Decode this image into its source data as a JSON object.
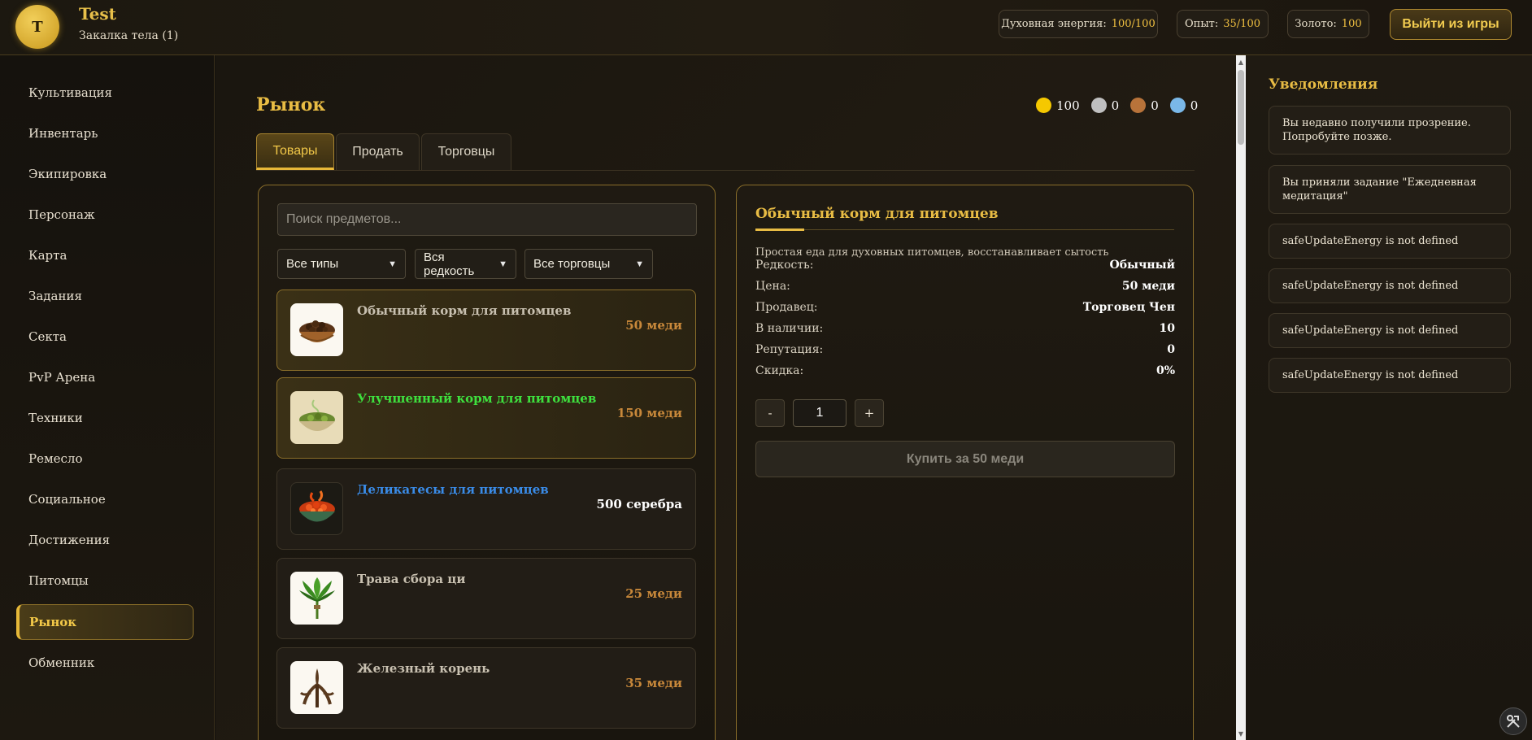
{
  "player": {
    "avatar_letter": "T",
    "name": "Test",
    "realm": "Закалка тела (1)"
  },
  "stats": {
    "energy_label": "Духовная энергия:",
    "energy_value": "100/100",
    "exp_label": "Опыт:",
    "exp_value": "35/100",
    "gold_label": "Золото:",
    "gold_value": "100"
  },
  "header": {
    "exit_label": "Выйти из игры"
  },
  "sidebar": {
    "items": [
      {
        "label": "Культивация"
      },
      {
        "label": "Инвентарь"
      },
      {
        "label": "Экипировка"
      },
      {
        "label": "Персонаж"
      },
      {
        "label": "Карта"
      },
      {
        "label": "Задания"
      },
      {
        "label": "Секта"
      },
      {
        "label": "PvP Арена"
      },
      {
        "label": "Техники"
      },
      {
        "label": "Ремесло"
      },
      {
        "label": "Социальное"
      },
      {
        "label": "Достижения"
      },
      {
        "label": "Питомцы"
      },
      {
        "label": "Рынок",
        "active": true
      },
      {
        "label": "Обменник"
      }
    ]
  },
  "market": {
    "title": "Рынок",
    "currencies": [
      {
        "value": "100",
        "color": "#f5c800"
      },
      {
        "value": "0",
        "color": "#c0c0c0"
      },
      {
        "value": "0",
        "color": "#b8733a"
      },
      {
        "value": "0",
        "color": "#7ab8e8"
      }
    ],
    "tabs": [
      {
        "label": "Товары",
        "active": true
      },
      {
        "label": "Продать"
      },
      {
        "label": "Торговцы"
      }
    ],
    "search_placeholder": "Поиск предметов...",
    "filters": {
      "type": "Все типы",
      "rarity": "Вся редкость",
      "trader": "Все торговцы"
    },
    "items": [
      {
        "name": "Обычный корм для питомцев",
        "price": "50 меди",
        "name_color": "#c8c0b0",
        "price_color": "#c8883a",
        "icon": "pet-food-bowl-icon",
        "selected": true
      },
      {
        "name": "Улучшенный корм для питомцев",
        "price": "150 меди",
        "name_color": "#3ee03e",
        "price_color": "#c8883a",
        "icon": "improved-pet-food-icon",
        "selected": true
      },
      {
        "name": "Деликатесы для питомцев",
        "price": "500 серебра",
        "name_color": "#3a8ce8",
        "price_color": "#ffffff",
        "icon": "pet-delicacy-icon"
      },
      {
        "name": "Трава сбора ци",
        "price": "25 меди",
        "name_color": "#c8c0b0",
        "price_color": "#c8883a",
        "icon": "qi-herb-icon"
      },
      {
        "name": "Железный корень",
        "price": "35 меди",
        "name_color": "#c8c0b0",
        "price_color": "#c8883a",
        "icon": "iron-root-icon"
      }
    ]
  },
  "detail": {
    "title": "Обычный корм для питомцев",
    "description": "Простая еда для духовных питомцев, восстанавливает сытость",
    "props": [
      {
        "key": "Редкость:",
        "value": "Обычный"
      },
      {
        "key": "Цена:",
        "value": "50 меди"
      },
      {
        "key": "Продавец:",
        "value": "Торговец Чен"
      },
      {
        "key": "В наличии:",
        "value": "10"
      },
      {
        "key": "Репутация:",
        "value": "0"
      },
      {
        "key": "Скидка:",
        "value": "0%"
      }
    ],
    "minus": "-",
    "plus": "+",
    "quantity": "1",
    "buy_label": "Купить за 50 меди"
  },
  "notifications": {
    "title": "Уведомления",
    "items": [
      "Вы недавно получили прозрение. Попробуйте позже.",
      "Вы приняли задание \"Ежедневная медитация\"",
      "safeUpdateEnergy is not defined",
      "safeUpdateEnergy is not defined",
      "safeUpdateEnergy is not defined",
      "safeUpdateEnergy is not defined"
    ]
  },
  "colors": {
    "accent": "#e8bc44",
    "panel_border": "#8a6e2a",
    "background": "#14110c"
  }
}
